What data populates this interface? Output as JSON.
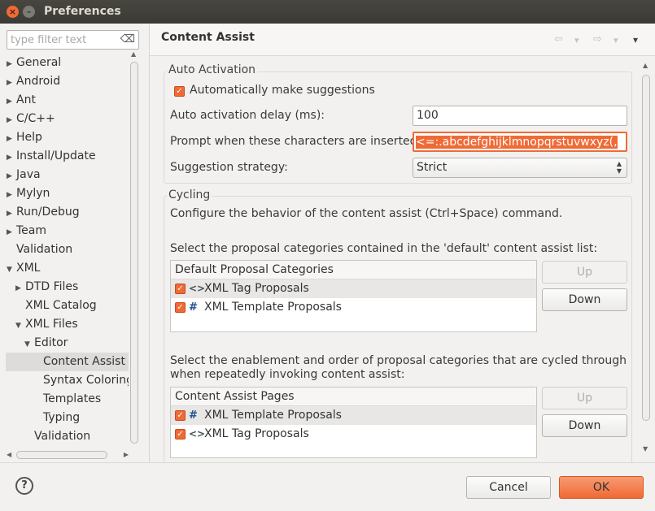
{
  "window": {
    "title": "Preferences",
    "close_icon": "×",
    "minimize_icon": "–"
  },
  "filter": {
    "placeholder": "type filter text",
    "clear_icon": "⌫"
  },
  "tree": [
    {
      "label": "General",
      "arrow": "▶",
      "indent": 0
    },
    {
      "label": "Android",
      "arrow": "▶",
      "indent": 0
    },
    {
      "label": "Ant",
      "arrow": "▶",
      "indent": 0
    },
    {
      "label": "C/C++",
      "arrow": "▶",
      "indent": 0
    },
    {
      "label": "Help",
      "arrow": "▶",
      "indent": 0
    },
    {
      "label": "Install/Update",
      "arrow": "▶",
      "indent": 0
    },
    {
      "label": "Java",
      "arrow": "▶",
      "indent": 0
    },
    {
      "label": "Mylyn",
      "arrow": "▶",
      "indent": 0
    },
    {
      "label": "Run/Debug",
      "arrow": "▶",
      "indent": 0
    },
    {
      "label": "Team",
      "arrow": "▶",
      "indent": 0
    },
    {
      "label": "Validation",
      "arrow": "",
      "indent": 0
    },
    {
      "label": "XML",
      "arrow": "▼",
      "indent": 0
    },
    {
      "label": "DTD Files",
      "arrow": "▶",
      "indent": 1
    },
    {
      "label": "XML Catalog",
      "arrow": "",
      "indent": 1
    },
    {
      "label": "XML Files",
      "arrow": "▼",
      "indent": 1
    },
    {
      "label": "Editor",
      "arrow": "▼",
      "indent": 2
    },
    {
      "label": "Content Assist",
      "arrow": "",
      "indent": 3,
      "selected": true
    },
    {
      "label": "Syntax Coloring",
      "arrow": "",
      "indent": 3
    },
    {
      "label": "Templates",
      "arrow": "",
      "indent": 3
    },
    {
      "label": "Typing",
      "arrow": "",
      "indent": 3
    },
    {
      "label": "Validation",
      "arrow": "",
      "indent": 2
    }
  ],
  "header": {
    "title": "Content Assist",
    "back_icon": "⇦",
    "forward_icon": "⇨",
    "dropdown_icon": "▾",
    "menu_icon": "▾"
  },
  "auto_activation": {
    "group_label": "Auto Activation",
    "auto_suggest_label": "Automatically make suggestions",
    "auto_suggest_checked": true,
    "delay_label": "Auto activation delay (ms):",
    "delay_value": "100",
    "prompt_label": "Prompt when these characters are inserted:",
    "prompt_value": "<=:.abcdefghijklmnopqrstuvwxyz(,",
    "strategy_label": "Suggestion strategy:",
    "strategy_value": "Strict"
  },
  "cycling": {
    "group_label": "Cycling",
    "description": "Configure the behavior of the content assist (Ctrl+Space) command.",
    "default_list_label": "Select the proposal categories contained in the 'default' content assist list:",
    "default_table": {
      "header": "Default Proposal Categories",
      "rows": [
        {
          "icon": "<>",
          "icon_name": "xml-tag-icon",
          "label": "XML Tag Proposals",
          "checked": true,
          "selected": true
        },
        {
          "icon": "#",
          "icon_name": "template-icon",
          "label": "XML Template Proposals",
          "checked": true,
          "selected": false
        }
      ]
    },
    "cycle_label_1": "Select the enablement and order of proposal categories that are cycled through",
    "cycle_label_2": "when repeatedly invoking content assist:",
    "pages_table": {
      "header": "Content Assist Pages",
      "rows": [
        {
          "icon": "#",
          "icon_name": "template-icon",
          "label": "XML Template Proposals",
          "checked": true,
          "selected": true
        },
        {
          "icon": "<>",
          "icon_name": "xml-tag-icon",
          "label": "XML Tag Proposals",
          "checked": true,
          "selected": false
        }
      ]
    },
    "up_label": "Up",
    "down_label": "Down"
  },
  "footer": {
    "help_icon": "?",
    "cancel_label": "Cancel",
    "ok_label": "OK"
  },
  "colors": {
    "accent": "#f06a35",
    "titlebar": "#3b3a35",
    "background": "#f2f1f0"
  }
}
